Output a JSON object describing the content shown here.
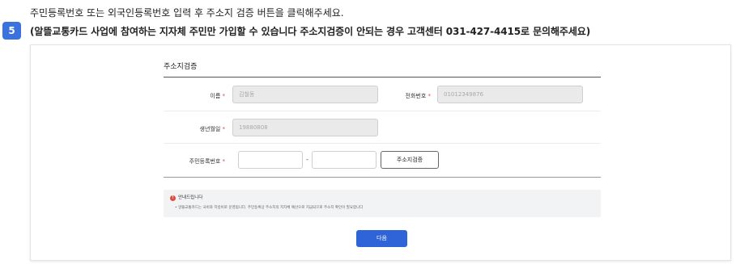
{
  "step": {
    "number": "5"
  },
  "instructions": {
    "line1": "주민등록번호 또는 외국인등록번호 입력 후 주소지 검증 버튼을 클릭해주세요.",
    "line2": "(알뜰교통카드 사업에 참여하는 지자체 주민만 가입할 수 있습니다 주소지검증이 안되는 경우 고객센터 031-427-4415로 문의해주세요)"
  },
  "form": {
    "title": "주소지검증",
    "required_mark": "*",
    "name": {
      "label": "이름",
      "value": "김철동"
    },
    "phone": {
      "label": "전화번호",
      "value": "01012349876"
    },
    "birth": {
      "label": "생년월일",
      "value": "19880808"
    },
    "rrn": {
      "label": "주민등록번호",
      "front": "",
      "back": "",
      "separator": "-"
    },
    "verify_button": "주소지검증"
  },
  "notice": {
    "icon": "!",
    "title": "안내드립니다",
    "body": "• 알뜰교통카드는 국비와 지방비로 운영됩니다. 주민등록상 주소지의 지자체 예산으로 지급되므로 주소지 확인이 필요합니다"
  },
  "next_button": "다음",
  "colors": {
    "accent": "#2f63d8",
    "badge": "#3a73de",
    "required": "#e0493e"
  }
}
